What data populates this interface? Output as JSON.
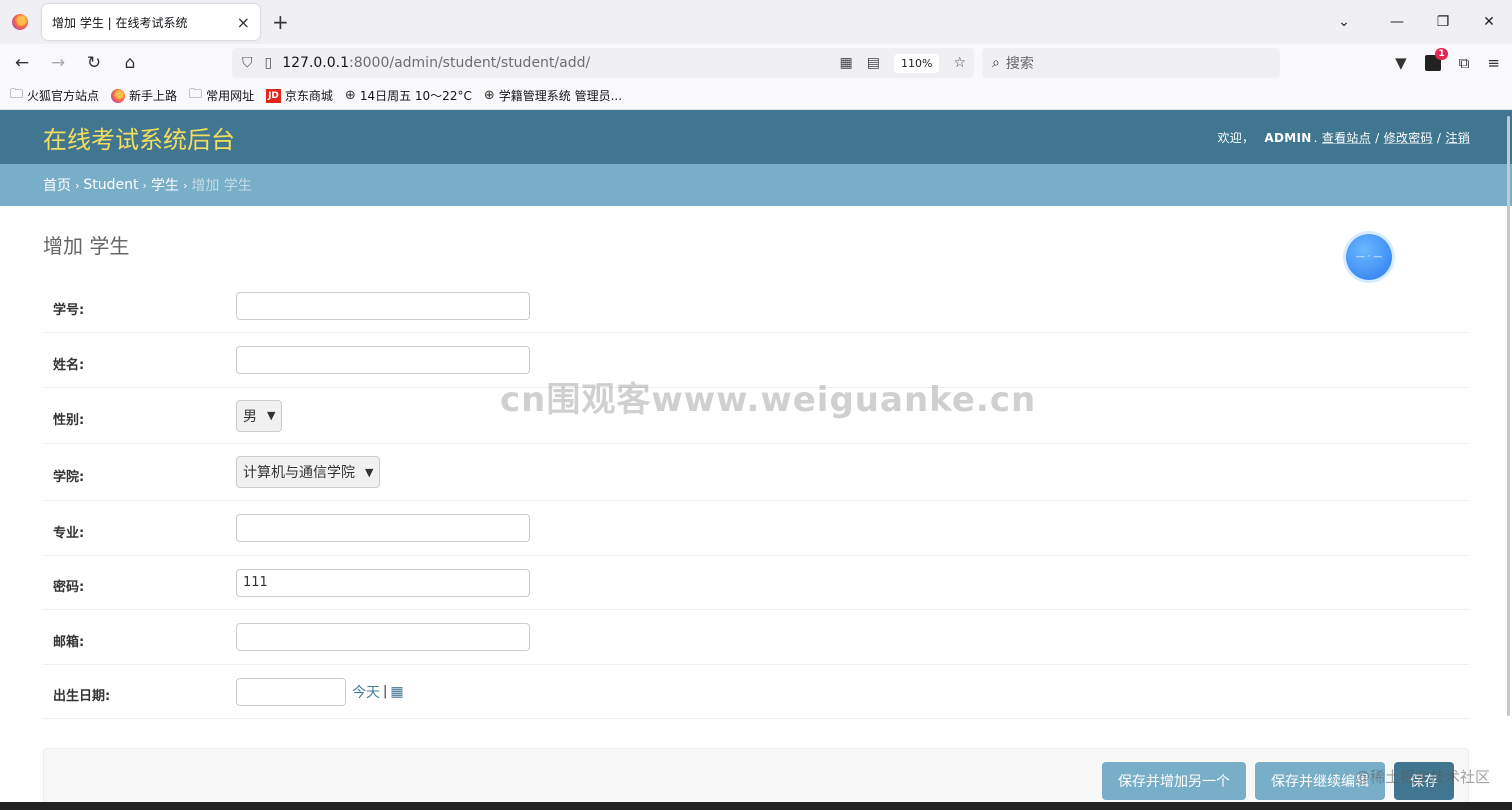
{
  "browser": {
    "tab_title": "增加 学生 | 在线考试系统",
    "tab_close": "×",
    "new_tab": "+",
    "url_host": "127.0.0.1",
    "url_path": ":8000/admin/student/student/add/",
    "zoom": "110%",
    "search_placeholder": "搜索",
    "extension_badge": "1",
    "bookmarks": [
      "火狐官方站点",
      "新手上路",
      "常用网址",
      "京东商城",
      "14日周五  10～22°C",
      "学籍管理系统 管理员..."
    ]
  },
  "header": {
    "site_title": "在线考试系统后台",
    "welcome": "欢迎，",
    "username": "ADMIN",
    "view_site": "查看站点",
    "change_password": "修改密码",
    "logout": "注销",
    "sep": "/"
  },
  "breadcrumbs": {
    "home": "首页",
    "app": "Student",
    "model": "学生",
    "current": "增加 学生",
    "sep": "›"
  },
  "page": {
    "title": "增加 学生"
  },
  "form": {
    "student_no": {
      "label": "学号:",
      "value": ""
    },
    "name": {
      "label": "姓名:",
      "value": ""
    },
    "gender": {
      "label": "性别:",
      "value": "男"
    },
    "college": {
      "label": "学院:",
      "value": "计算机与通信学院"
    },
    "major": {
      "label": "专业:",
      "value": ""
    },
    "password": {
      "label": "密码:",
      "value": "111"
    },
    "email": {
      "label": "邮箱:",
      "value": ""
    },
    "birthday": {
      "label": "出生日期:",
      "value": "",
      "today": "今天",
      "pipe": "|"
    }
  },
  "buttons": {
    "save_add_another": "保存并增加另一个",
    "save_continue": "保存并继续编辑",
    "save": "保存"
  },
  "watermarks": {
    "center": "cn围观客www.weiguanke.cn",
    "corner": "@稀土掘金技术社区"
  }
}
